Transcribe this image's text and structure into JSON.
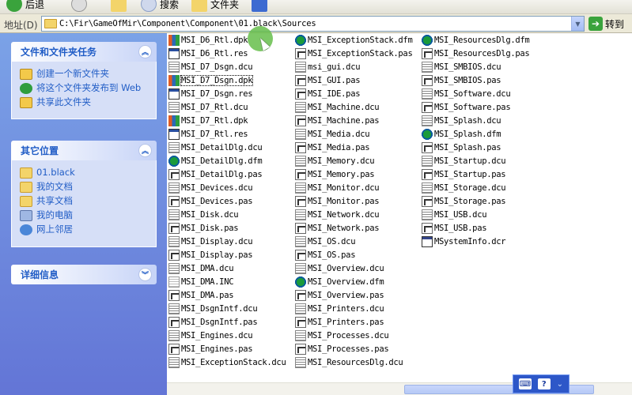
{
  "toolbar": {
    "back_label": "后退",
    "search_label": "搜索",
    "folders_label": "文件夹"
  },
  "address": {
    "label": "地址(D)",
    "path": "C:\\Fir\\GameOfMir\\Component\\Component\\01.black\\Sources",
    "go_label": "转到"
  },
  "taskpane": {
    "tasks": {
      "title": "文件和文件夹任务",
      "items": [
        {
          "label": "创建一个新文件夹",
          "icon": "new-folder-icon"
        },
        {
          "label": "将这个文件夹发布到 Web",
          "icon": "publish-web-icon"
        },
        {
          "label": "共享此文件夹",
          "icon": "share-folder-icon"
        }
      ]
    },
    "places": {
      "title": "其它位置",
      "items": [
        {
          "label": "01.black",
          "icon": "folder-icon"
        },
        {
          "label": "我的文档",
          "icon": "my-documents-icon"
        },
        {
          "label": "共享文档",
          "icon": "shared-documents-icon"
        },
        {
          "label": "我的电脑",
          "icon": "my-computer-icon"
        },
        {
          "label": "网上邻居",
          "icon": "network-places-icon"
        }
      ]
    },
    "details": {
      "title": "详细信息"
    }
  },
  "files": {
    "col1": [
      {
        "name": "MSI_D6_Rtl.dpk",
        "type": "dpk"
      },
      {
        "name": "MSI_D6_Rtl.res",
        "type": "res"
      },
      {
        "name": "MSI_D7_Dsgn.dcu",
        "type": "dcu"
      },
      {
        "name": "MSI_D7_Dsgn.dpk",
        "type": "dpk"
      },
      {
        "name": "MSI_D7_Dsgn.res",
        "type": "res"
      },
      {
        "name": "MSI_D7_Rtl.dcu",
        "type": "dcu"
      },
      {
        "name": "MSI_D7_Rtl.dpk",
        "type": "dpk"
      },
      {
        "name": "MSI_D7_Rtl.res",
        "type": "res"
      },
      {
        "name": "MSI_DetailDlg.dcu",
        "type": "dcu"
      },
      {
        "name": "MSI_DetailDlg.dfm",
        "type": "dfm"
      },
      {
        "name": "MSI_DetailDlg.pas",
        "type": "pas"
      },
      {
        "name": "MSI_Devices.dcu",
        "type": "dcu"
      },
      {
        "name": "MSI_Devices.pas",
        "type": "pas"
      },
      {
        "name": "MSI_Disk.dcu",
        "type": "dcu"
      },
      {
        "name": "MSI_Disk.pas",
        "type": "pas"
      },
      {
        "name": "MSI_Display.dcu",
        "type": "dcu"
      },
      {
        "name": "MSI_Display.pas",
        "type": "pas"
      },
      {
        "name": "MSI_DMA.dcu",
        "type": "dcu"
      },
      {
        "name": "MSI_DMA.INC",
        "type": "inc"
      },
      {
        "name": "MSI_DMA.pas",
        "type": "pas"
      },
      {
        "name": "MSI_DsgnIntf.dcu",
        "type": "dcu"
      },
      {
        "name": "MSI_DsgnIntf.pas",
        "type": "pas"
      },
      {
        "name": "MSI_Engines.dcu",
        "type": "dcu"
      },
      {
        "name": "MSI_Engines.pas",
        "type": "pas"
      },
      {
        "name": "MSI_ExceptionStack.dcu",
        "type": "dcu"
      }
    ],
    "col2": [
      {
        "name": "MSI_ExceptionStack.dfm",
        "type": "dfm"
      },
      {
        "name": "MSI_ExceptionStack.pas",
        "type": "pas"
      },
      {
        "name": "msi_gui.dcu",
        "type": "dcu"
      },
      {
        "name": "MSI_GUI.pas",
        "type": "pas"
      },
      {
        "name": "MSI_IDE.pas",
        "type": "pas"
      },
      {
        "name": "MSI_Machine.dcu",
        "type": "dcu"
      },
      {
        "name": "MSI_Machine.pas",
        "type": "pas"
      },
      {
        "name": "MSI_Media.dcu",
        "type": "dcu"
      },
      {
        "name": "MSI_Media.pas",
        "type": "pas"
      },
      {
        "name": "MSI_Memory.dcu",
        "type": "dcu"
      },
      {
        "name": "MSI_Memory.pas",
        "type": "pas"
      },
      {
        "name": "MSI_Monitor.dcu",
        "type": "dcu"
      },
      {
        "name": "MSI_Monitor.pas",
        "type": "pas"
      },
      {
        "name": "MSI_Network.dcu",
        "type": "dcu"
      },
      {
        "name": "MSI_Network.pas",
        "type": "pas"
      },
      {
        "name": "MSI_OS.dcu",
        "type": "dcu"
      },
      {
        "name": "MSI_OS.pas",
        "type": "pas"
      },
      {
        "name": "MSI_Overview.dcu",
        "type": "dcu"
      },
      {
        "name": "MSI_Overview.dfm",
        "type": "dfm"
      },
      {
        "name": "MSI_Overview.pas",
        "type": "pas"
      },
      {
        "name": "MSI_Printers.dcu",
        "type": "dcu"
      },
      {
        "name": "MSI_Printers.pas",
        "type": "pas"
      },
      {
        "name": "MSI_Processes.dcu",
        "type": "dcu"
      },
      {
        "name": "MSI_Processes.pas",
        "type": "pas"
      },
      {
        "name": "MSI_ResourcesDlg.dcu",
        "type": "dcu"
      }
    ],
    "col3": [
      {
        "name": "MSI_ResourcesDlg.dfm",
        "type": "dfm"
      },
      {
        "name": "MSI_ResourcesDlg.pas",
        "type": "pas"
      },
      {
        "name": "MSI_SMBIOS.dcu",
        "type": "dcu"
      },
      {
        "name": "MSI_SMBIOS.pas",
        "type": "pas"
      },
      {
        "name": "MSI_Software.dcu",
        "type": "dcu"
      },
      {
        "name": "MSI_Software.pas",
        "type": "pas"
      },
      {
        "name": "MSI_Splash.dcu",
        "type": "dcu"
      },
      {
        "name": "MSI_Splash.dfm",
        "type": "dfm"
      },
      {
        "name": "MSI_Splash.pas",
        "type": "pas"
      },
      {
        "name": "MSI_Startup.dcu",
        "type": "dcu"
      },
      {
        "name": "MSI_Startup.pas",
        "type": "pas"
      },
      {
        "name": "MSI_Storage.dcu",
        "type": "dcu"
      },
      {
        "name": "MSI_Storage.pas",
        "type": "pas"
      },
      {
        "name": "MSI_USB.dcu",
        "type": "dcu"
      },
      {
        "name": "MSI_USB.pas",
        "type": "pas"
      },
      {
        "name": "MSystemInfo.dcr",
        "type": "dcr"
      }
    ]
  },
  "langbar": {
    "help_label": "?"
  },
  "colors": {
    "taskpane_top": "#7ba2e7",
    "taskpane_bottom": "#6375d6",
    "link": "#215dc6",
    "cursor_highlight": "#66be4b"
  }
}
